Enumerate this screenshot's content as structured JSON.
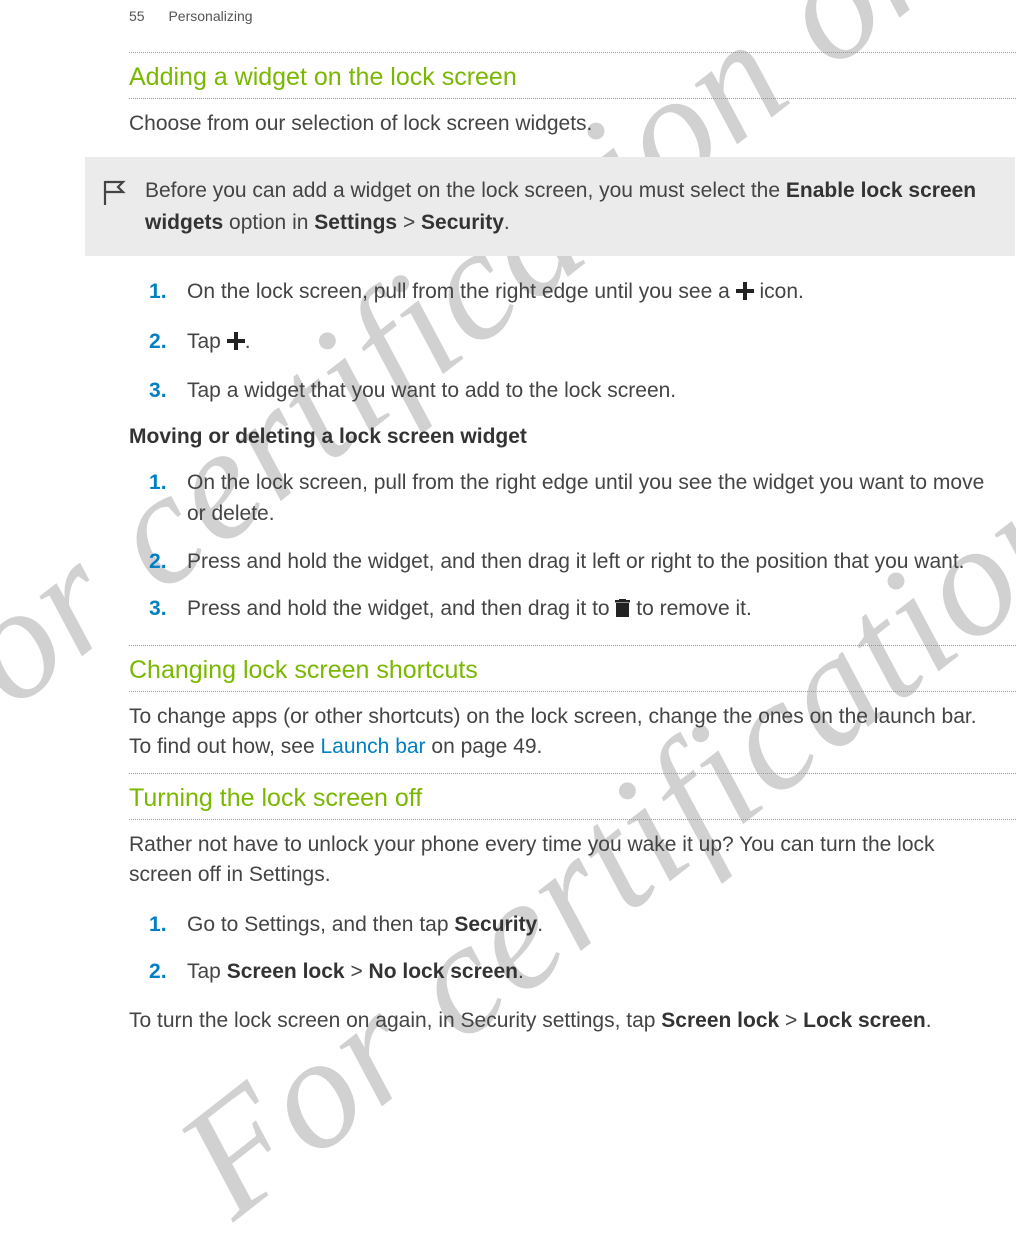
{
  "header": {
    "page_number": "55",
    "chapter": "Personalizing"
  },
  "watermark_text": "For certification only",
  "section1": {
    "title": "Adding a widget on the lock screen",
    "intro": "Choose from our selection of lock screen widgets.",
    "note_prefix": "Before you can add a widget on the lock screen, you must select the ",
    "note_bold1": "Enable lock screen widgets",
    "note_mid": " option in ",
    "note_bold2": "Settings",
    "note_gt": " > ",
    "note_bold3": "Security",
    "note_end": ".",
    "steps": {
      "s1_a": "On the lock screen, pull from the right edge until you see a ",
      "s1_b": " icon.",
      "s2_a": "Tap ",
      "s2_b": ".",
      "s3": "Tap a widget that you want to add to the lock screen."
    },
    "sub_title": "Moving or deleting a lock screen widget",
    "sub_steps": {
      "s1": "On the lock screen, pull from the right edge until you see the widget you want to move or delete.",
      "s2": "Press and hold the widget, and then drag it left or right to the position that you want.",
      "s3_a": "Press and hold the widget, and then drag it to ",
      "s3_b": " to remove it."
    }
  },
  "section2": {
    "title": "Changing lock screen shortcuts",
    "text_a": "To change apps (or other shortcuts) on the lock screen, change the ones on the launch bar. To find out how, see ",
    "link": "Launch bar",
    "text_b": " on page 49."
  },
  "section3": {
    "title": "Turning the lock screen off",
    "intro": "Rather not have to unlock your phone every time you wake it up? You can turn the lock screen off in Settings.",
    "steps": {
      "s1_a": "Go to Settings, and then tap ",
      "s1_b": "Security",
      "s1_c": ".",
      "s2_a": "Tap ",
      "s2_b": "Screen lock",
      "s2_c": " > ",
      "s2_d": "No lock screen",
      "s2_e": "."
    },
    "outro_a": "To turn the lock screen on again, in Security settings, tap ",
    "outro_b": "Screen lock",
    "outro_c": " > ",
    "outro_d": "Lock screen",
    "outro_e": "."
  }
}
